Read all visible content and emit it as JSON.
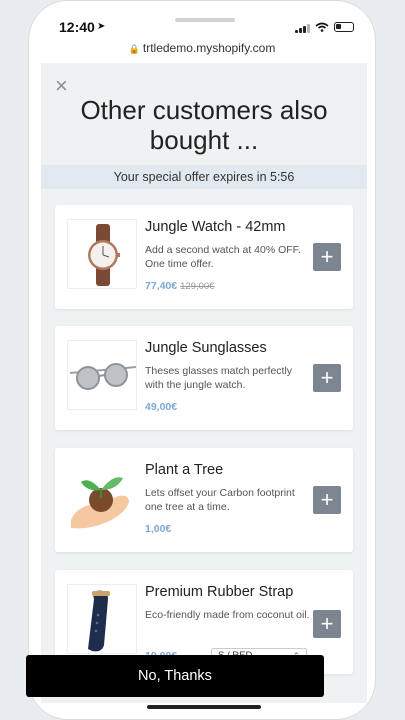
{
  "status_bar": {
    "time": "12:40"
  },
  "browser": {
    "url": "trtledemo.myshopify.com"
  },
  "popup": {
    "close_symbol": "×",
    "title_line1": "Other customers also",
    "title_line2": "bought ...",
    "offer_text": "Your special offer expires in 5:56",
    "add_symbol": "+",
    "products": [
      {
        "title": "Jungle Watch - 42mm",
        "description": "Add a second watch at 40% OFF. One time offer.",
        "price": "77,40€",
        "compare_price": "129,00€",
        "icon": "watch-image"
      },
      {
        "title": "Jungle Sunglasses",
        "description": "Theses glasses match perfectly with the jungle watch.",
        "price": "49,00€",
        "icon": "sunglasses-image"
      },
      {
        "title": "Plant a Tree",
        "description": "Lets offset your Carbon footprint one tree at a time.",
        "price": "1,00€",
        "icon": "plant-in-hand-image"
      },
      {
        "title": "Premium Rubber Strap",
        "description": "Eco-friendly made from coconut oil.",
        "price": "19,00€",
        "variant": "S / RED",
        "icon": "rubber-strap-image"
      }
    ],
    "decline_label": "No, Thanks"
  },
  "colors": {
    "price_blue": "#7ea8d4",
    "add_button": "#7c8590",
    "decline_button": "#000000",
    "offer_strip": "#e2e8f0"
  }
}
